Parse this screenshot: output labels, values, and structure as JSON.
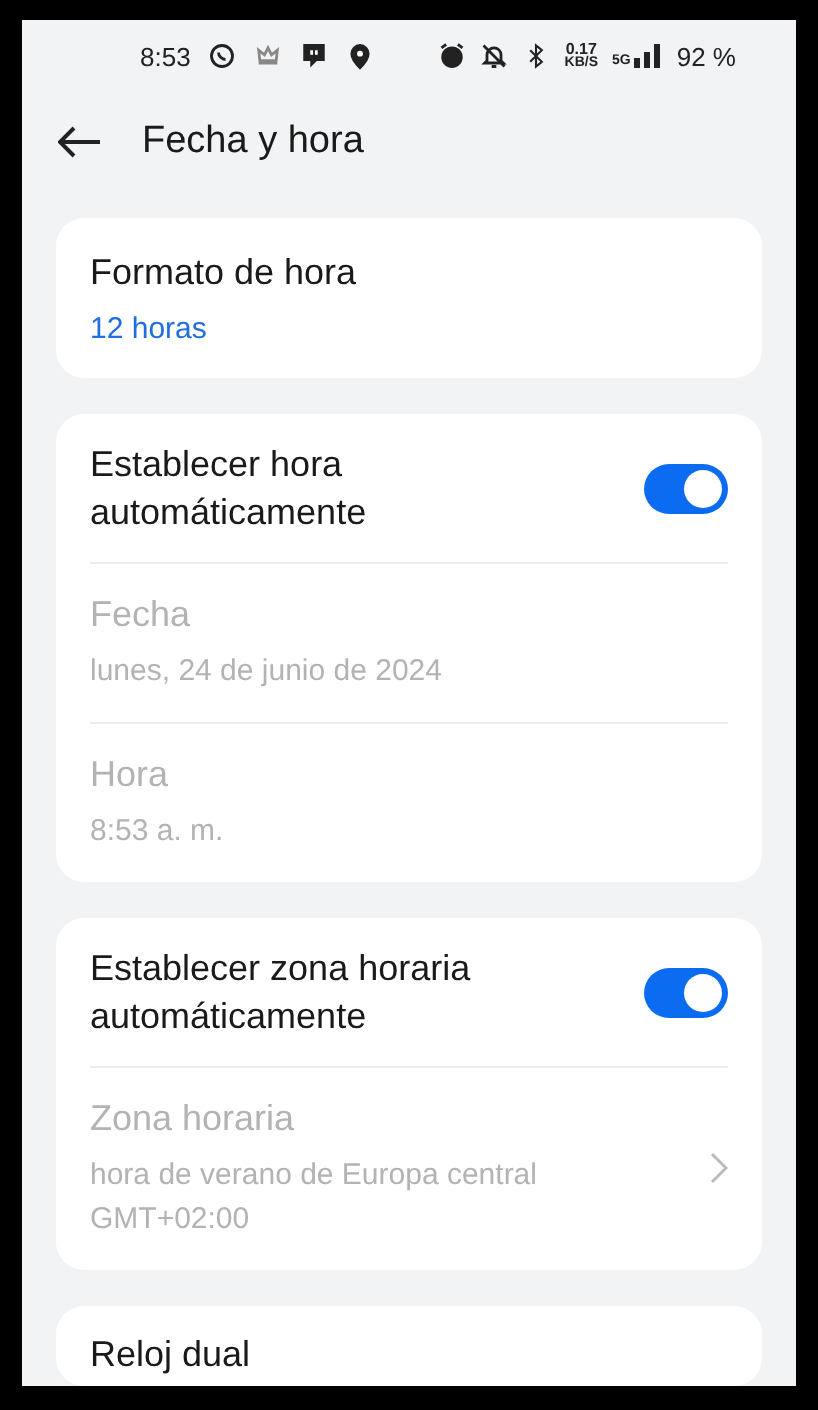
{
  "status_bar": {
    "time": "8:53",
    "net_speed": "0.17",
    "net_unit": "KB/S",
    "network": "5G",
    "battery": "92 %"
  },
  "header": {
    "title": "Fecha y hora"
  },
  "sections": [
    {
      "items": [
        {
          "kind": "value",
          "title": "Formato de hora",
          "value": "12 horas",
          "disabled": false
        }
      ]
    },
    {
      "items": [
        {
          "kind": "toggle",
          "title": "Establecer hora automáticamente",
          "on": true
        },
        {
          "kind": "value",
          "title": "Fecha",
          "value": "lunes, 24 de junio de 2024",
          "disabled": true
        },
        {
          "kind": "value",
          "title": "Hora",
          "value": "8:53 a. m.",
          "disabled": true
        }
      ]
    },
    {
      "items": [
        {
          "kind": "toggle",
          "title": "Establecer zona horaria automáticamente",
          "on": true
        },
        {
          "kind": "link",
          "title": "Zona horaria",
          "value": "hora de verano de Europa central GMT+02:00",
          "disabled": true
        }
      ]
    },
    {
      "items": [
        {
          "kind": "heading",
          "title": "Reloj dual"
        }
      ]
    }
  ]
}
